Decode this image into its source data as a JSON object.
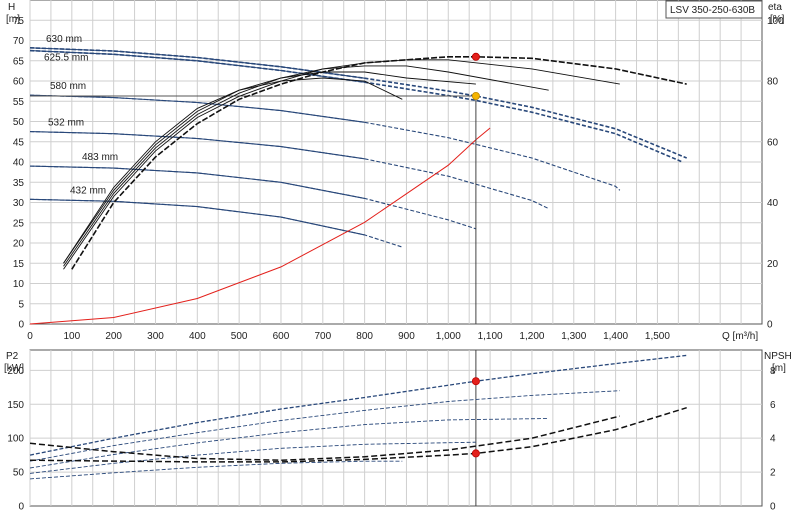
{
  "chart_data": [
    {
      "type": "line",
      "name": "pump-curves",
      "title_box": "LSV 350-250-630B",
      "xlabel": "Q [m³/h]",
      "x_ticks": [
        "0",
        "100",
        "200",
        "300",
        "400",
        "500",
        "600",
        "700",
        "800",
        "900",
        "1,000",
        "1,100",
        "1,200",
        "1,300",
        "1,400",
        "1,500"
      ],
      "xlim": [
        0,
        1750
      ],
      "left_axis": {
        "label_top": "H",
        "label_unit": "[m]",
        "ylim": [
          0,
          80
        ],
        "ticks": [
          "0",
          "5",
          "10",
          "15",
          "20",
          "25",
          "30",
          "35",
          "40",
          "45",
          "50",
          "55",
          "60",
          "65",
          "70",
          "75"
        ]
      },
      "right_axis": {
        "label_top": "eta",
        "label_unit": "[%]",
        "ylim": [
          0,
          106.7
        ],
        "ticks": [
          "0",
          "20",
          "40",
          "60",
          "80",
          "100"
        ]
      },
      "head_curves": [
        {
          "name": "630 mm",
          "points": [
            [
              0,
              68.2
            ],
            [
              200,
              67.4
            ],
            [
              400,
              65.8
            ],
            [
              600,
              63.5
            ],
            [
              800,
              60.7
            ],
            [
              1000,
              57.5
            ],
            [
              1066,
              56.3
            ],
            [
              1200,
              53.5
            ],
            [
              1400,
              48.2
            ],
            [
              1570,
              41.0
            ]
          ]
        },
        {
          "name": "625.5 mm",
          "points": [
            [
              0,
              67.5
            ],
            [
              200,
              66.6
            ],
            [
              400,
              65.0
            ],
            [
              600,
              62.6
            ],
            [
              800,
              59.7
            ],
            [
              1000,
              56.4
            ],
            [
              1066,
              55.2
            ],
            [
              1200,
              52.3
            ],
            [
              1400,
              47.0
            ],
            [
              1560,
              40.0
            ]
          ]
        },
        {
          "name": "580 mm",
          "points": [
            [
              0,
              56.5
            ],
            [
              200,
              55.9
            ],
            [
              400,
              54.7
            ],
            [
              600,
              52.7
            ],
            [
              800,
              49.8
            ],
            [
              1000,
              46.0
            ],
            [
              1200,
              41.0
            ],
            [
              1400,
              34.0
            ],
            [
              1410,
              33.0
            ]
          ]
        },
        {
          "name": "532 mm",
          "points": [
            [
              0,
              47.5
            ],
            [
              200,
              47.0
            ],
            [
              400,
              45.8
            ],
            [
              600,
              43.8
            ],
            [
              800,
              40.8
            ],
            [
              1000,
              36.5
            ],
            [
              1200,
              30.5
            ],
            [
              1240,
              28.5
            ]
          ]
        },
        {
          "name": "483 mm",
          "points": [
            [
              0,
              39.0
            ],
            [
              200,
              38.5
            ],
            [
              400,
              37.3
            ],
            [
              600,
              35.0
            ],
            [
              800,
              31.0
            ],
            [
              1000,
              25.7
            ],
            [
              1066,
              23.5
            ]
          ]
        },
        {
          "name": "432 mm",
          "points": [
            [
              0,
              30.8
            ],
            [
              200,
              30.3
            ],
            [
              400,
              29.0
            ],
            [
              600,
              26.4
            ],
            [
              800,
              22.0
            ],
            [
              890,
              19.0
            ]
          ]
        }
      ],
      "system_curve": {
        "name": "",
        "points": [
          [
            0,
            0
          ],
          [
            200,
            1.6
          ],
          [
            400,
            6.3
          ],
          [
            600,
            14.1
          ],
          [
            800,
            25.1
          ],
          [
            1000,
            39.2
          ],
          [
            1066,
            45.5
          ],
          [
            1100,
            48.4
          ]
        ]
      },
      "eta_curves": [
        {
          "name": "630 mm",
          "points": [
            [
              100,
              18
            ],
            [
              200,
              40
            ],
            [
              300,
              55
            ],
            [
              400,
              66
            ],
            [
              500,
              74
            ],
            [
              600,
              79
            ],
            [
              700,
              83
            ],
            [
              800,
              86
            ],
            [
              900,
              87
            ],
            [
              1000,
              88
            ],
            [
              1066,
              88
            ],
            [
              1200,
              87.5
            ],
            [
              1400,
              84
            ],
            [
              1570,
              79
            ]
          ]
        },
        {
          "name": "580 mm",
          "points": [
            [
              80,
              18
            ],
            [
              200,
              42
            ],
            [
              300,
              57
            ],
            [
              400,
              68
            ],
            [
              500,
              75
            ],
            [
              600,
              80
            ],
            [
              700,
              84
            ],
            [
              800,
              86
            ],
            [
              900,
              87
            ],
            [
              1000,
              87
            ],
            [
              1200,
              84
            ],
            [
              1410,
              79
            ]
          ]
        },
        {
          "name": "532 mm",
          "points": [
            [
              80,
              19
            ],
            [
              200,
              43
            ],
            [
              300,
              58
            ],
            [
              400,
              69
            ],
            [
              500,
              76
            ],
            [
              600,
              81
            ],
            [
              700,
              84
            ],
            [
              800,
              85
            ],
            [
              900,
              85
            ],
            [
              1000,
              83
            ],
            [
              1240,
              77
            ]
          ]
        },
        {
          "name": "483 mm",
          "points": [
            [
              80,
              20
            ],
            [
              200,
              44
            ],
            [
              300,
              59
            ],
            [
              400,
              70
            ],
            [
              500,
              77
            ],
            [
              600,
              81
            ],
            [
              700,
              83
            ],
            [
              800,
              83
            ],
            [
              900,
              81
            ],
            [
              1066,
              79
            ]
          ]
        },
        {
          "name": "432 mm",
          "points": [
            [
              80,
              20
            ],
            [
              200,
              45
            ],
            [
              300,
              60
            ],
            [
              400,
              71
            ],
            [
              500,
              77
            ],
            [
              600,
              80
            ],
            [
              700,
              81
            ],
            [
              800,
              80
            ],
            [
              890,
              74
            ]
          ]
        }
      ],
      "markers": [
        {
          "name": "duty point head",
          "x": 1066,
          "y": 56.3,
          "axis": "left",
          "color": "#f4b400"
        },
        {
          "name": "duty point eta",
          "x": 1066,
          "y": 88,
          "axis": "right",
          "color": "#e3201b"
        }
      ]
    },
    {
      "type": "line",
      "name": "power-npsh-curves",
      "left_axis": {
        "label_top": "P2",
        "label_unit": "[kW]",
        "ylim": [
          0,
          230
        ],
        "ticks": [
          "0",
          "50",
          "100",
          "150",
          "200"
        ]
      },
      "right_axis": {
        "label_top": "NPSH",
        "label_unit": "[m]",
        "ylim": [
          0,
          9.2
        ],
        "ticks": [
          "0",
          "2",
          "4",
          "6",
          "8"
        ]
      },
      "xlim": [
        0,
        1750
      ],
      "power_curves": [
        {
          "name": "630 mm",
          "points": [
            [
              0,
              75
            ],
            [
              200,
              100
            ],
            [
              400,
              123
            ],
            [
              600,
              143
            ],
            [
              800,
              160
            ],
            [
              1066,
              184
            ],
            [
              1200,
              195
            ],
            [
              1400,
              210
            ],
            [
              1570,
              222
            ]
          ]
        },
        {
          "name": "580 mm",
          "points": [
            [
              0,
              66
            ],
            [
              200,
              89
            ],
            [
              400,
              108
            ],
            [
              600,
              126
            ],
            [
              800,
              141
            ],
            [
              1000,
              154
            ],
            [
              1200,
              163
            ],
            [
              1410,
              170
            ]
          ]
        },
        {
          "name": "532 mm",
          "points": [
            [
              0,
              56
            ],
            [
              200,
              76
            ],
            [
              400,
              93
            ],
            [
              600,
              108
            ],
            [
              800,
              120
            ],
            [
              1000,
              127
            ],
            [
              1240,
              129
            ]
          ]
        },
        {
          "name": "483 mm",
          "points": [
            [
              0,
              48
            ],
            [
              200,
              63
            ],
            [
              400,
              75
            ],
            [
              600,
              85
            ],
            [
              800,
              91
            ],
            [
              1066,
              94
            ]
          ]
        },
        {
          "name": "432 mm",
          "points": [
            [
              0,
              40
            ],
            [
              200,
              49
            ],
            [
              400,
              57
            ],
            [
              600,
              63
            ],
            [
              800,
              66
            ],
            [
              890,
              66
            ]
          ]
        }
      ],
      "npsh_curves": [
        {
          "name": "630 mm",
          "points": [
            [
              0,
              2.7
            ],
            [
              200,
              2.65
            ],
            [
              400,
              2.6
            ],
            [
              600,
              2.6
            ],
            [
              800,
              2.75
            ],
            [
              1000,
              3.0
            ],
            [
              1066,
              3.1
            ],
            [
              1200,
              3.5
            ],
            [
              1400,
              4.5
            ],
            [
              1570,
              5.8
            ]
          ]
        },
        {
          "name": "580 mm",
          "points": [
            [
              0,
              3.7
            ],
            [
              200,
              3.2
            ],
            [
              400,
              2.8
            ],
            [
              600,
              2.7
            ],
            [
              800,
              2.9
            ],
            [
              1000,
              3.3
            ],
            [
              1200,
              4.0
            ],
            [
              1410,
              5.3
            ]
          ]
        }
      ],
      "markers": [
        {
          "name": "duty point power",
          "x": 1066,
          "y": 184,
          "axis": "left",
          "color": "#e3201b"
        },
        {
          "name": "duty point npsh",
          "x": 1066,
          "y": 3.1,
          "axis": "right",
          "color": "#e3201b"
        }
      ]
    }
  ]
}
